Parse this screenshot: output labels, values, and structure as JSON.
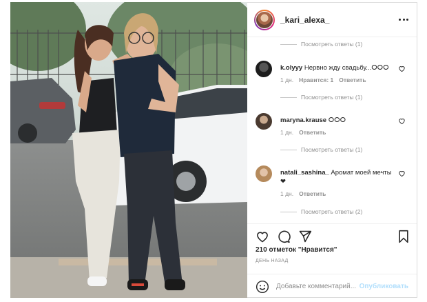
{
  "post": {
    "username": "_kari_alexa_",
    "likes": "210 отметок \"Нравится\"",
    "date": "ДЕНЬ НАЗАД",
    "add_comment_placeholder": "Добавьте комментарий...",
    "publish_label": "Опубликовать"
  },
  "comments": {
    "view_replies_top": "Посмотреть ответы (1)",
    "items": [
      {
        "user": "k.olyyy",
        "text": "Нервно жду свадьбу...ⵔⵔⵔ",
        "time": "1 дн.",
        "likes": "Нравится: 1",
        "reply": "Ответить",
        "view_replies": "Посмотреть ответы (1)"
      },
      {
        "user": "maryna.krause",
        "text": "ⵔⵔⵔ",
        "time": "1 дн.",
        "reply": "Ответить",
        "view_replies": "Посмотреть ответы (1)"
      },
      {
        "user": "natali_sashina_",
        "text": "Аромат моей мечты ❤",
        "time": "1 дн.",
        "reply": "Ответить",
        "view_replies": "Посмотреть ответы (2)"
      }
    ]
  },
  "icons": {
    "like": "heart-icon",
    "comment": "comment-icon",
    "share": "share-icon",
    "save": "bookmark-icon",
    "more": "more-icon",
    "emoji": "emoji-icon"
  },
  "colors": {
    "text": "#262626",
    "muted": "#8e8e8e",
    "publish_disabled": "#b2dffc"
  }
}
